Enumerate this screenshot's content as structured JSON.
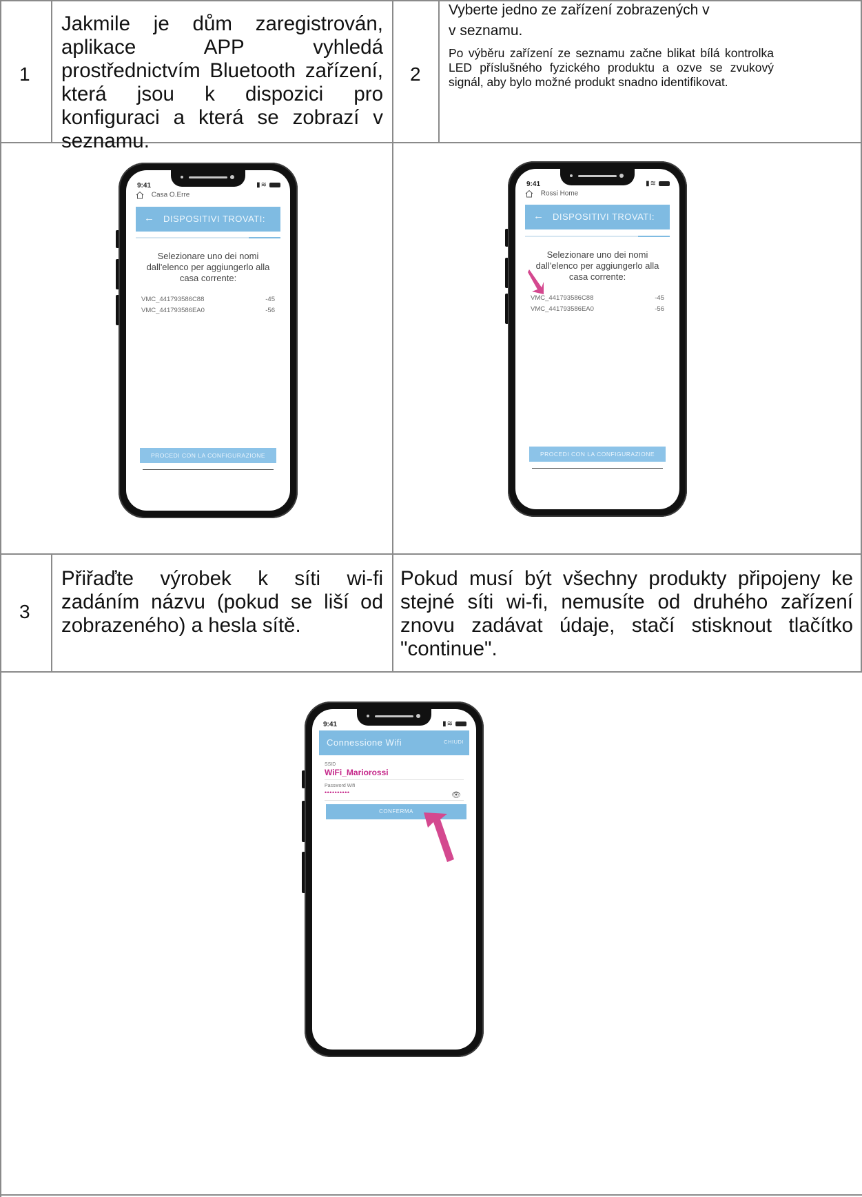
{
  "steps": {
    "step1": {
      "number": "1",
      "text": "Jakmile je dům zaregistrován, aplikace APP vyhledá prostřednictvím Bluetooth zařízení, která jsou k dispozici pro konfiguraci a která se zobrazí v seznamu."
    },
    "step2": {
      "number": "2",
      "title_line1": "Vyberte jedno ze zařízení zobrazených v",
      "title_line2": "v seznamu.",
      "body": "Po výběru zařízení ze seznamu začne blikat bílá kontrolka LED příslušného fyzického produktu a ozve se zvukový signál, aby bylo možné produkt snadno identifikovat."
    },
    "step3": {
      "number": "3",
      "text": "Přiřaďte výrobek k síti wi-fi zadáním názvu (pokud se liší od zobrazeného) a hesla sítě.",
      "note": "Pokud musí být všechny produkty připojeny ke stejné síti wi-fi, nemusíte od druhého zařízení znovu zadávat údaje, stačí stisknout tlačítko \"continue\"."
    }
  },
  "phone1": {
    "time": "9:41",
    "home_name": "Casa O.Erre",
    "appbar_title": "DISPOSITIVI TROVATI:",
    "back_arrow": "←",
    "instruction": "Selezionare uno dei nomi dall'elenco per aggiungerlo alla casa corrente:",
    "devices": [
      {
        "name": "VMC_441793586C88",
        "rssi": "-45"
      },
      {
        "name": "VMC_441793586EA0",
        "rssi": "-56"
      }
    ],
    "proceed_label": "PROCEDI CON LA CONFIGURAZIONE"
  },
  "phone2": {
    "time": "9:41",
    "home_name": "Rossi Home",
    "appbar_title": "DISPOSITIVI TROVATI:",
    "back_arrow": "←",
    "instruction": "Selezionare uno dei nomi dall'elenco per aggiungerlo alla casa corrente:",
    "devices": [
      {
        "name": "VMC_441793586C88",
        "rssi": "-45"
      },
      {
        "name": "VMC_441793586EA0",
        "rssi": "-56"
      }
    ],
    "proceed_label": "PROCEDI CON LA CONFIGURAZIONE"
  },
  "phone3": {
    "time": "9:41",
    "appbar_title": "Connessione Wifi",
    "close_label": "CHIUDI",
    "ssid_label": "SSID",
    "ssid_value": "WiFi_Mariorossi",
    "password_label": "Password Wifi",
    "password_value": "••••••••••",
    "confirm_label": "CONFERMA"
  },
  "colors": {
    "appbar": "#7fbbe2",
    "highlight": "#c5288a",
    "pointer_arrow": "#d4488f"
  },
  "icons": [
    "home-icon",
    "back-arrow-icon",
    "signal-icon",
    "wifi-icon",
    "battery-icon",
    "eye-icon",
    "pointer-arrow-icon"
  ]
}
